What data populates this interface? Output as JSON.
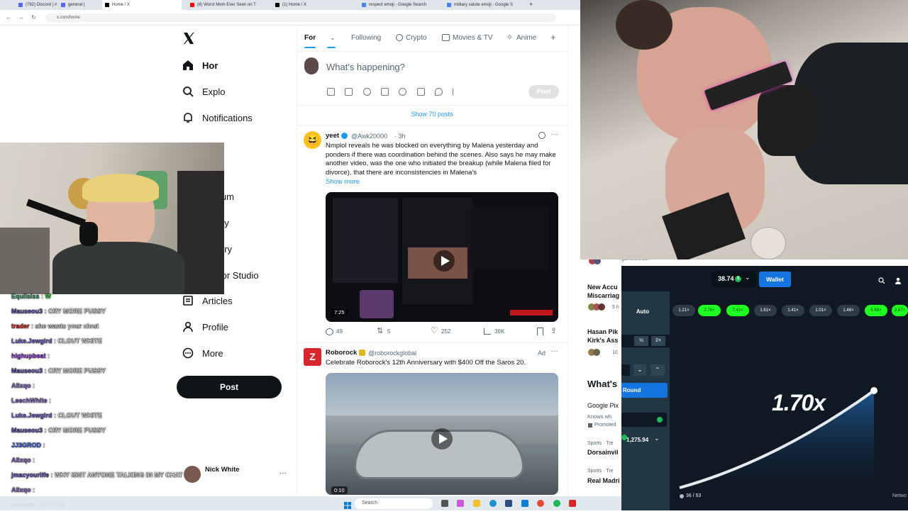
{
  "browser": {
    "tabs": [
      {
        "label": "(782) Discord | #",
        "color": "#5865f2"
      },
      {
        "label": "general | ",
        "color": "#5865f2"
      },
      {
        "label": "Home / X",
        "color": "#000000"
      },
      {
        "label": "(8) Worst Mom Ever Seen on T",
        "color": "#ff0000"
      },
      {
        "label": "(1) Home / X",
        "color": "#000000"
      },
      {
        "label": "respect emoji - Google Search",
        "color": "#4285f4"
      },
      {
        "label": "military salute emoji - Google S",
        "color": "#4285f4"
      }
    ],
    "url": "x.com/home"
  },
  "x_nav": {
    "items": [
      {
        "label": "Hor",
        "icon": "home-icon"
      },
      {
        "label": "Explo",
        "icon": "search-icon"
      },
      {
        "label": "Notifications",
        "icon": "bell-icon"
      },
      {
        "label": "ium",
        "icon": "premium-icon"
      },
      {
        "label": "ey",
        "icon": "money-icon"
      },
      {
        "label": "ory",
        "icon": "verified-icon"
      },
      {
        "label": "tor Studio",
        "icon": "studio-icon"
      },
      {
        "label": "Articles",
        "icon": "article-icon"
      },
      {
        "label": "Profile",
        "icon": "person-icon"
      },
      {
        "label": "More",
        "icon": "more-circle-icon"
      }
    ],
    "post_label": "Post",
    "account_name": "Nick White"
  },
  "timeline": {
    "tabs": [
      "For",
      "Following",
      "Crypto",
      "Movies & TV",
      "Anime"
    ],
    "compose_placeholder": "What's happening?",
    "compose_post": "Post",
    "show_posts": "Show 70 posts",
    "tweet1": {
      "name": "yeet",
      "handle": "@Awk20000",
      "time": "· 3h",
      "text": "Nmplol reveals he was blocked on everything by Malena yesterday and ponders if there was coordination behind the scenes. Also says he may make another video, was the one who initiated the breakup (while Malena filed for divorce), that there are inconsistencies in Malena's",
      "show_more": "Show more",
      "video_time": "7:25",
      "replies": "49",
      "reposts": "5",
      "likes": "252",
      "views": "36K"
    },
    "tweet2": {
      "name": "Roborock",
      "handle": "@roborockglobal",
      "ad": "Ad",
      "text": "Celebrate Roborock's 12th Anniversary with $400 Off the Saros 20.",
      "video_time": "0:10"
    }
  },
  "chat": [
    {
      "user": "Equilsiss",
      "msg": "W",
      "user_color": "#3cb371",
      "msg_color": "#42e642"
    },
    {
      "user": "Mauseou3",
      "msg": "CRY MORE PUSSY",
      "user_color": "#6a5acd",
      "msg_color": "#ffffff"
    },
    {
      "user": "trader",
      "msg": "she wants your clout",
      "user_color": "#ff2020",
      "msg_color": "#ffffff"
    },
    {
      "user": "Luke.Jewgird",
      "msg": "CLOUT WHITE",
      "user_color": "#7b68ee",
      "msg_color": "#ffffff"
    },
    {
      "user": "highupbeat",
      "msg": "",
      "user_color": "#b040ff",
      "msg_color": "#ffffff"
    },
    {
      "user": "Mauseou3",
      "msg": "CRY MORE PUSSY",
      "user_color": "#6a5acd",
      "msg_color": "#ffffff"
    },
    {
      "user": "Alixqo",
      "msg": "",
      "user_color": "#9370db",
      "msg_color": "#ffffff"
    },
    {
      "user": "LeechWhite",
      "msg": "",
      "user_color": "#9370db",
      "msg_color": "#ffffff"
    },
    {
      "user": "Luke.Jewgird",
      "msg": "CLOUT WHITE",
      "user_color": "#7b68ee",
      "msg_color": "#ffffff"
    },
    {
      "user": "Mauseou3",
      "msg": "CRY MORE PUSSY",
      "user_color": "#6a5acd",
      "msg_color": "#ffffff"
    },
    {
      "user": "JJ3GROD",
      "msg": "",
      "user_color": "#3f6bff",
      "msg_color": "#ffffff"
    },
    {
      "user": "Alixqo",
      "msg": "",
      "user_color": "#9370db",
      "msg_color": "#ffffff"
    },
    {
      "user": "jmacyourlife",
      "msg": "WHY ISNT ANYONE TALKING IN MY CHAT",
      "user_color": "#6a5acd",
      "msg_color": "#ffffff"
    },
    {
      "user": "Alixqo",
      "msg": "",
      "user_color": "#9370db",
      "msg_color": "#ffffff"
    },
    {
      "user": "prosato",
      "msg": "MOTION",
      "user_color": "#7b68ee",
      "msg_color": "#ffffff"
    }
  ],
  "sidebar": {
    "url_fragment": "/games/crash",
    "trend1": "New Accu\nMiscarriag",
    "trend1_sub": "5 h",
    "trend2": "Hasan Pik\nKirk's Ass",
    "trend2_sub": "10",
    "whats": "What's",
    "promo_title": "Google Pix",
    "promo_sub": "Knows wh",
    "promo_label": "Promoted",
    "trend3_cat": "Sports · Tre",
    "trend3": "Dorsainvil",
    "trend4_cat": "Sports · Tre",
    "trend4": "Real Madri"
  },
  "game": {
    "balance": "38.74",
    "wallet": "Wallet",
    "auto": "Auto",
    "multipliers": [
      {
        "v": "1.21×",
        "hit": false
      },
      {
        "v": "2.76×",
        "hit": true
      },
      {
        "v": "7.42×",
        "hit": true
      },
      {
        "v": "1.61×",
        "hit": false
      },
      {
        "v": "1.41×",
        "hit": false
      },
      {
        "v": "1.01×",
        "hit": false
      },
      {
        "v": "1.46×",
        "hit": false
      },
      {
        "v": "5.68×",
        "hit": true
      },
      {
        "v": "2.87×",
        "hit": true
      }
    ],
    "half": "½",
    "double": "2×",
    "round": "Round",
    "amount": "1,275.94",
    "current": "1.70x",
    "players": "36 / 53",
    "network": "Netwo"
  },
  "taskbar": {
    "search": "Search"
  },
  "colors": {
    "x_blue": "#1d9bf0",
    "crash_green": "#1fff20",
    "game_bg": "#1a242d",
    "wallet_blue": "#1475e1"
  }
}
